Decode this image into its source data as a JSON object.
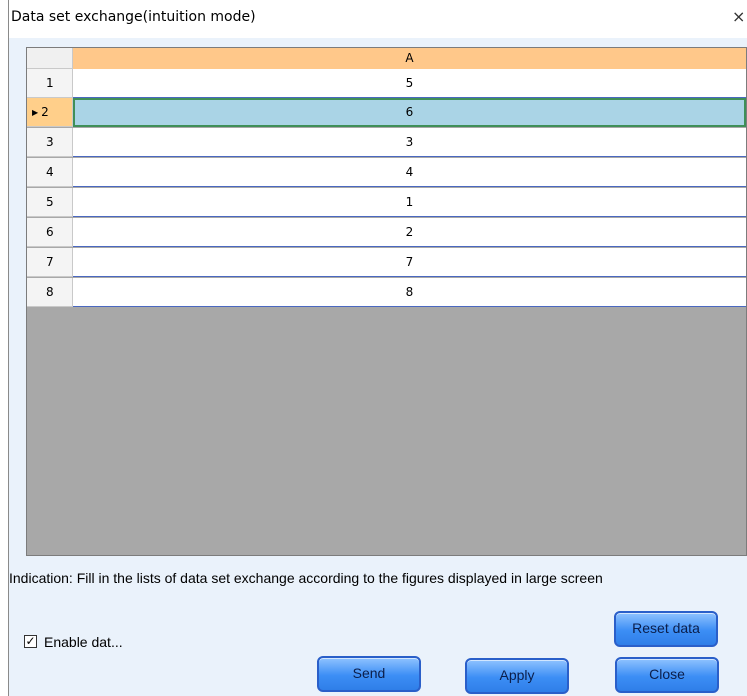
{
  "window": {
    "title": "Data set exchange(intuition mode)",
    "close_glyph": "×"
  },
  "grid": {
    "column_header": "A",
    "current_marker": "▶",
    "rows": [
      {
        "num": "1",
        "value": "5"
      },
      {
        "num": "2",
        "value": "6"
      },
      {
        "num": "3",
        "value": "3"
      },
      {
        "num": "4",
        "value": "4"
      },
      {
        "num": "5",
        "value": "1"
      },
      {
        "num": "6",
        "value": "2"
      },
      {
        "num": "7",
        "value": "7"
      },
      {
        "num": "8",
        "value": "8"
      }
    ]
  },
  "hint": "Indication: Fill in the lists of data set exchange according to the figures displayed in large screen",
  "buttons": {
    "reset": "Reset data",
    "send": "Send",
    "apply": "Apply",
    "close": "Close"
  },
  "enable": {
    "checked_glyph": "✓",
    "label": "Enable dat..."
  }
}
